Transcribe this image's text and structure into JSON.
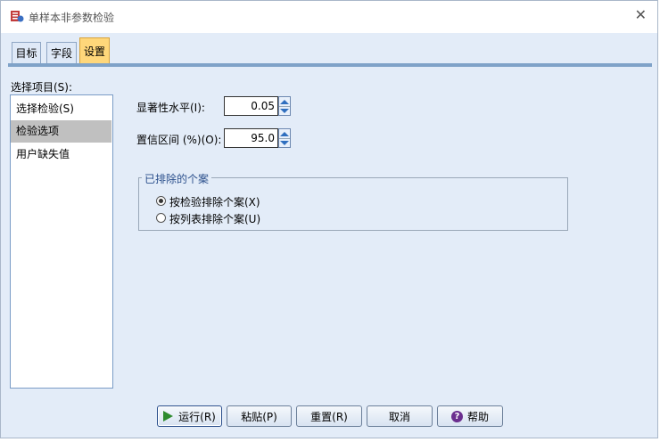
{
  "window": {
    "title": "单样本非参数检验",
    "close_glyph": "✕"
  },
  "tabs": [
    {
      "label": "目标"
    },
    {
      "label": "字段"
    },
    {
      "label": "设置"
    }
  ],
  "selection": {
    "label": "选择项目(S):",
    "items": [
      {
        "label": "选择检验(S)"
      },
      {
        "label": "检验选项"
      },
      {
        "label": "用户缺失值"
      }
    ],
    "selected_index": 1
  },
  "options": {
    "significance": {
      "label": "显著性水平(I):",
      "value": "0.05"
    },
    "confidence": {
      "label": "置信区间 (%)(O):",
      "value": "95.0"
    }
  },
  "excluded_cases": {
    "title": "已排除的个案",
    "options": [
      {
        "label": "按检验排除个案(X)",
        "selected": true
      },
      {
        "label": "按列表排除个案(U)",
        "selected": false
      }
    ]
  },
  "buttons": {
    "run": "运行(R)",
    "paste": "粘贴(P)",
    "reset": "重置(R)",
    "cancel": "取消",
    "help": "帮助",
    "help_glyph": "?"
  }
}
